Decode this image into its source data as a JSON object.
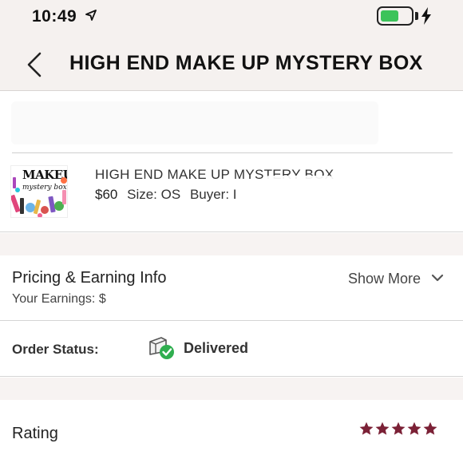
{
  "status_bar": {
    "time": "10:49",
    "battery_level": 0.6,
    "icons": [
      "location-arrow-icon",
      "battery-icon",
      "charging-bolt-icon"
    ]
  },
  "header": {
    "title": "HIGH END MAKE UP MYSTERY BOX",
    "back_icon": "chevron-left-icon"
  },
  "listing": {
    "thumbnail_title": "MAKEUP",
    "thumbnail_subtitle": "mystery box",
    "title": "HIGH END MAKE UP MYSTERY BOX",
    "price": "$60",
    "size": "Size: OS",
    "buyer": "Buyer: I"
  },
  "pricing": {
    "title": "Pricing & Earning Info",
    "earnings": "Your Earnings: $",
    "show_more": "Show More"
  },
  "order": {
    "label": "Order Status:",
    "status": "Delivered"
  },
  "rating": {
    "label": "Rating",
    "stars": 5,
    "max_stars": 5
  },
  "colors": {
    "header_bg": "#f5f1ef",
    "star": "#7b2136",
    "delivered_check": "#2fae4f",
    "battery": "#3cc35a"
  }
}
